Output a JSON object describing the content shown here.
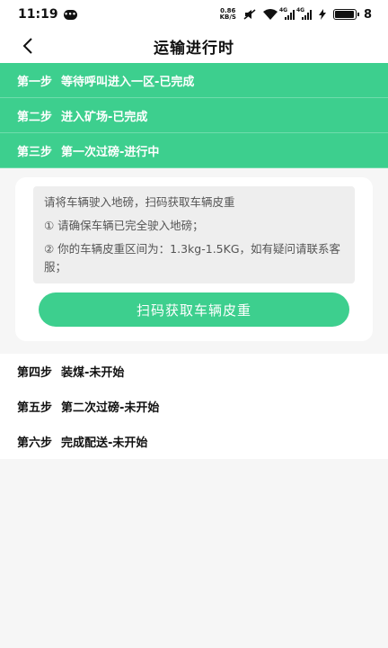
{
  "status_bar": {
    "time": "11:19",
    "net_speed_value": "0.86",
    "net_speed_unit": "KB/S",
    "signal_label_1": "4G",
    "signal_label_2": "4G",
    "battery_level": "8"
  },
  "nav": {
    "title": "运输进行时"
  },
  "completed_steps": [
    {
      "step": "第一步",
      "text": "等待呼叫进入一区-已完成"
    },
    {
      "step": "第二步",
      "text": "进入矿场-已完成"
    },
    {
      "step": "第三步",
      "text": "第一次过磅-进行中"
    }
  ],
  "current_panel": {
    "instruction": "请将车辆驶入地磅，扫码获取车辆皮重",
    "note_1": "① 请确保车辆已完全驶入地磅；",
    "note_2": "② 你的车辆皮重区间为：1.3kg-1.5KG，如有疑问请联系客服；",
    "scan_button_label": "扫码获取车辆皮重"
  },
  "pending_steps": [
    {
      "step": "第四步",
      "text": "装煤-未开始"
    },
    {
      "step": "第五步",
      "text": "第二次过磅-未开始"
    },
    {
      "step": "第六步",
      "text": "完成配送-未开始"
    }
  ],
  "colors": {
    "accent": "#3dcf8e",
    "background": "#f6f6f6"
  }
}
